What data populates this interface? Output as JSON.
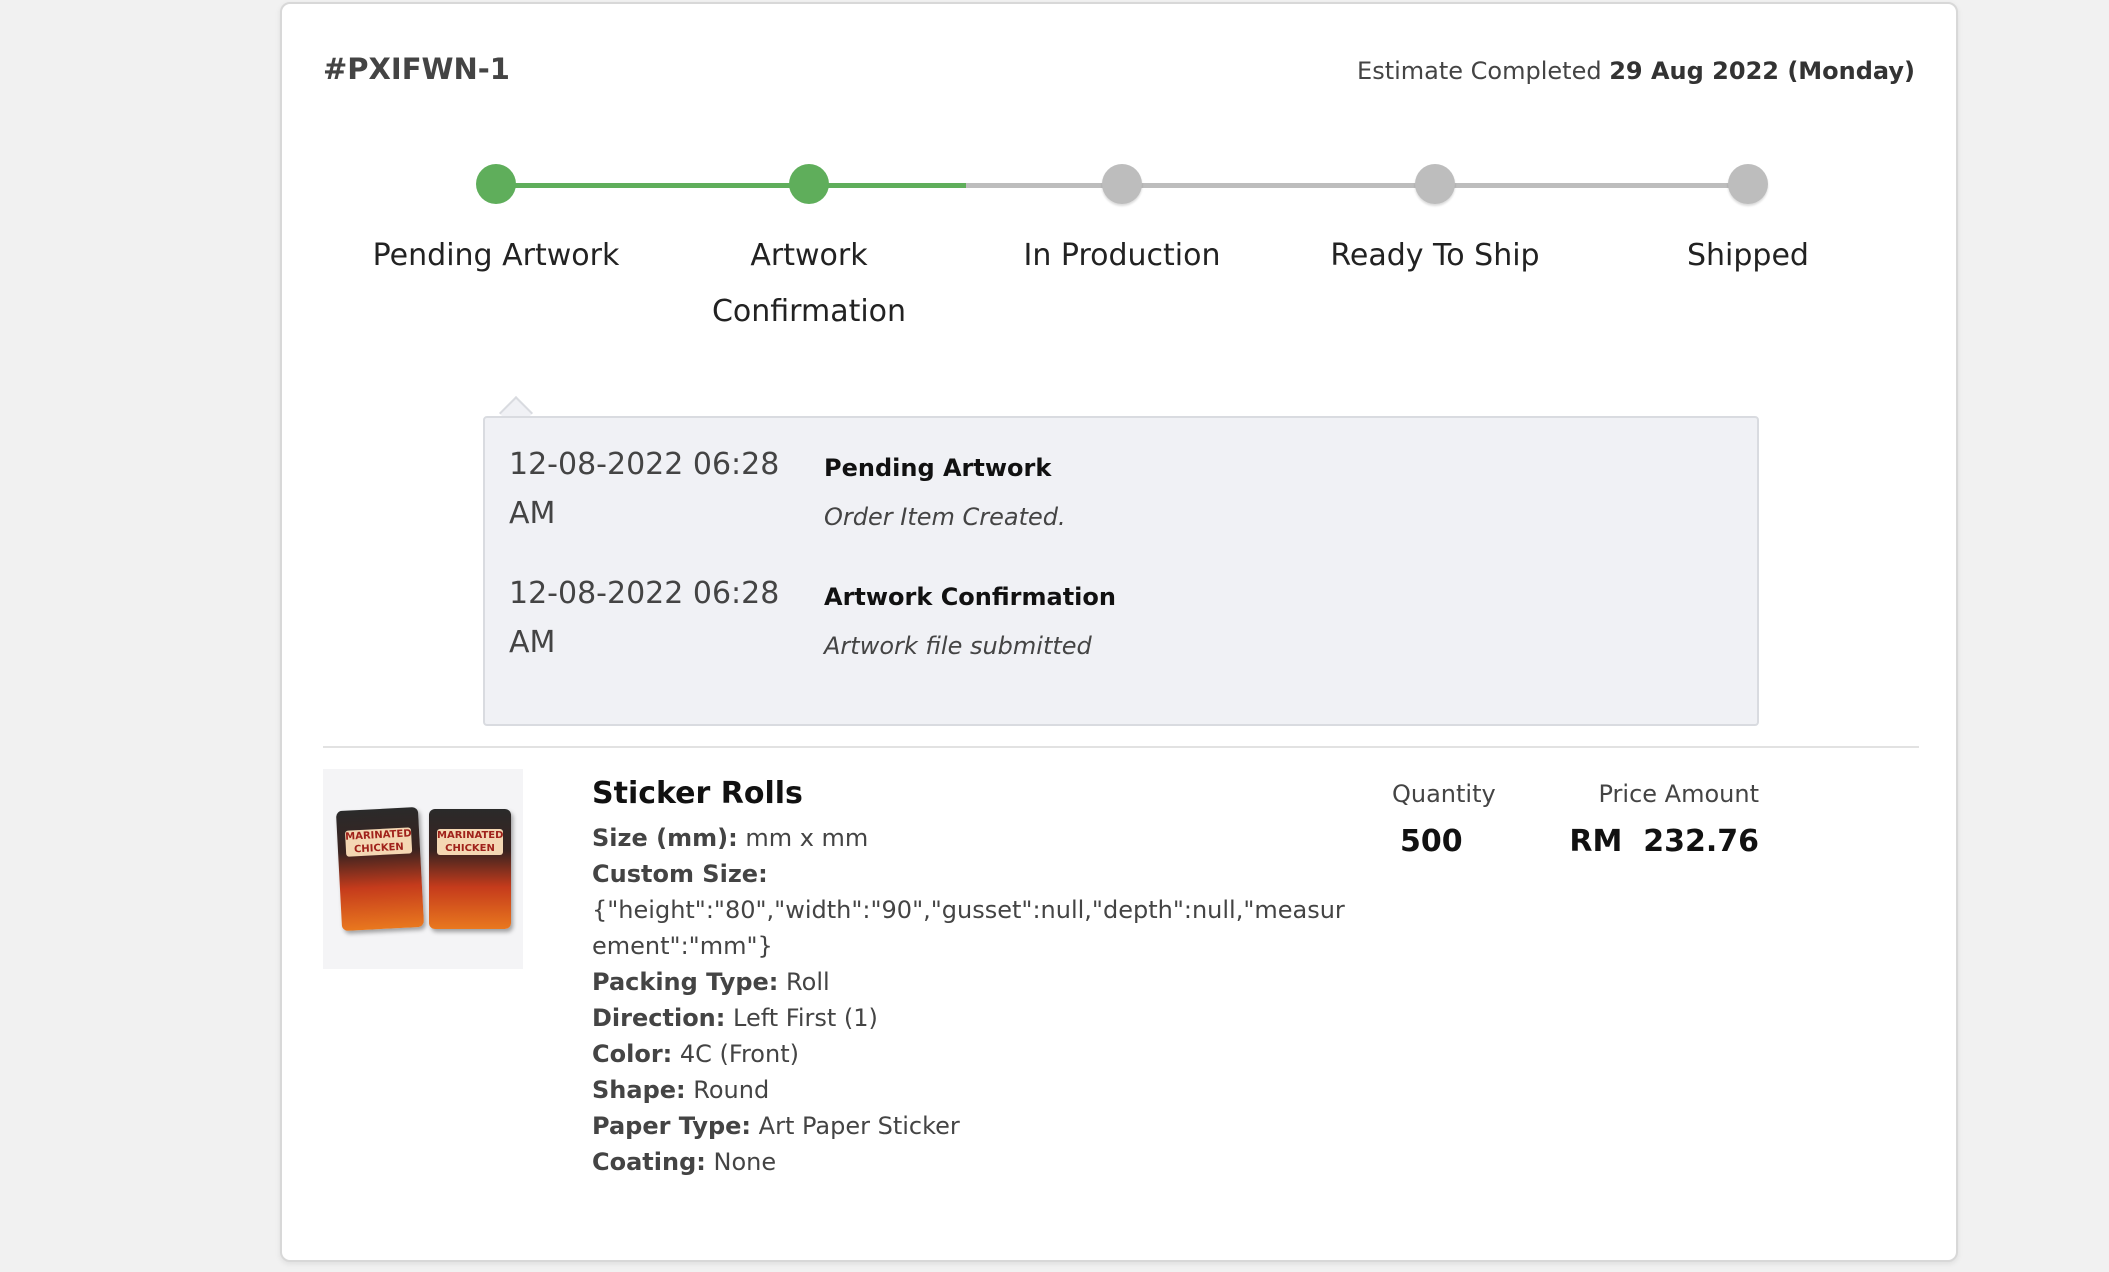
{
  "order": {
    "id": "#PXIFWN-1",
    "estimate_prefix": "Estimate Completed",
    "estimate_date": "29 Aug 2022 (Monday)"
  },
  "colors": {
    "done": "#5fae5b",
    "pending": "#bdbdbd"
  },
  "progress": {
    "completed_steps": 2,
    "steps": [
      {
        "label": "Pending Artwork"
      },
      {
        "label": "Artwork Confirmation"
      },
      {
        "label": "In Production"
      },
      {
        "label": "Ready To Ship"
      },
      {
        "label": "Shipped"
      }
    ]
  },
  "history": [
    {
      "time": "12-08-2022 06:28 AM",
      "title": "Pending Artwork",
      "description": "Order Item Created."
    },
    {
      "time": "12-08-2022 06:28 AM",
      "title": "Artwork Confirmation",
      "description": "Artwork file submitted"
    }
  ],
  "product": {
    "image_labels": [
      "MARINATED CHICKEN",
      "MARINATED CHICKEN"
    ],
    "title": "Sticker Rolls",
    "specs": [
      {
        "key": "Size (mm):",
        "value": "mm x mm"
      },
      {
        "key": "Custom Size:",
        "value": "{\"height\":\"80\",\"width\":\"90\",\"gusset\":null,\"depth\":null,\"measurement\":\"mm\"}"
      },
      {
        "key": "Packing Type:",
        "value": "Roll"
      },
      {
        "key": "Direction:",
        "value": "Left First (1)"
      },
      {
        "key": "Color:",
        "value": "4C (Front)"
      },
      {
        "key": "Shape:",
        "value": "Round"
      },
      {
        "key": "Paper Type:",
        "value": "Art Paper Sticker"
      },
      {
        "key": "Coating:",
        "value": "None"
      }
    ],
    "quantity_label": "Quantity",
    "quantity": "500",
    "price_label": "Price Amount",
    "currency": "RM",
    "price": "232.76"
  }
}
